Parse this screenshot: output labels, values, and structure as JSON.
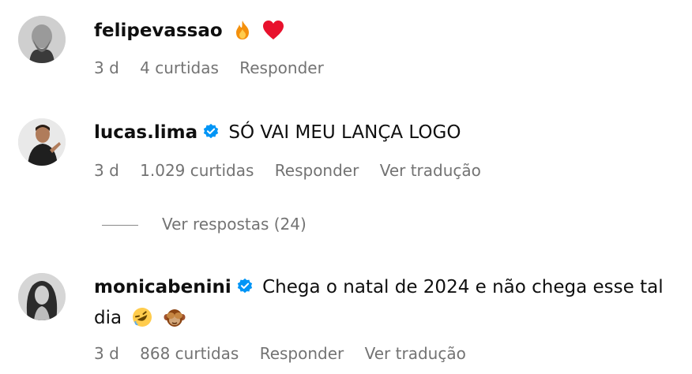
{
  "comments": [
    {
      "username": "felipevassao",
      "verified": false,
      "text": "",
      "emojis": [
        "fire-icon",
        "heart-icon"
      ],
      "time": "3 d",
      "likes": "4 curtidas",
      "reply_label": "Responder",
      "translate_label": ""
    },
    {
      "username": "lucas.lima",
      "verified": true,
      "text": "SÓ VAI MEU LANÇA LOGO",
      "time": "3 d",
      "likes": "1.029 curtidas",
      "reply_label": "Responder",
      "translate_label": "Ver tradução",
      "view_replies": "Ver respostas (24)"
    },
    {
      "username": "monicabenini",
      "verified": true,
      "text": "Chega o natal de 2024 e não chega esse tal dia",
      "emojis": [
        "rolling-laughing-icon",
        "see-no-evil-monkey-icon"
      ],
      "time": "3 d",
      "likes": "868 curtidas",
      "reply_label": "Responder",
      "translate_label": "Ver tradução"
    }
  ],
  "colors": {
    "text": "#0f0f0f",
    "meta": "#737373",
    "verified": "#0095f6"
  }
}
